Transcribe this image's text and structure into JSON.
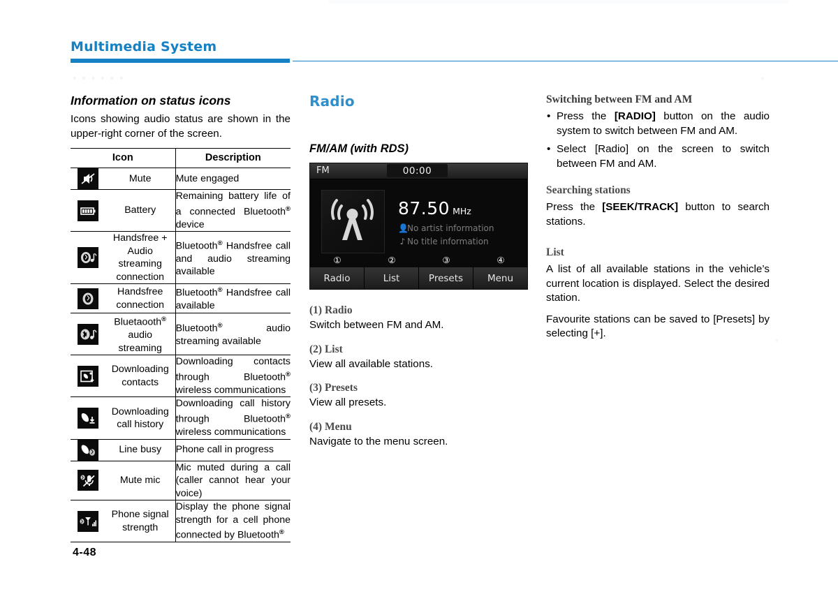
{
  "header": {
    "chapter_title": "Multimedia System",
    "rule_color": "#1580c4",
    "watermark": "• • • • • •",
    "watermark_right": "•",
    "watermark_mid": "•"
  },
  "page_number": "4-48",
  "column1": {
    "section_title": "Information on status icons",
    "intro": "Icons showing audio status are shown in the upper-right corner of the screen.",
    "table": {
      "headers": [
        "Icon",
        "Description"
      ],
      "rows": [
        {
          "icon": "mute-icon",
          "name": "Mute",
          "desc_html": "Mute engaged"
        },
        {
          "icon": "battery-icon",
          "name": "Battery",
          "desc_html": "Remaining battery life of a connected Bluetooth<sup class=\"sup-r\">®</sup> device"
        },
        {
          "icon": "handsfree-audio-streaming-icon",
          "name": "Handsfree + Audio streaming connection",
          "desc_html": "Bluetooth<sup class=\"sup-r\">®</sup> Handsfree call and audio streaming available"
        },
        {
          "icon": "handsfree-connection-icon",
          "name": "Handsfree connection",
          "desc_html": "Bluetooth<sup class=\"sup-r\">®</sup> Handsfree call available"
        },
        {
          "icon": "bluetooth-audio-streaming-icon",
          "name": "Bluetaooth<sup class=\"sup-r\">®</sup> audio streaming",
          "desc_html": "Bluetooth<sup class=\"sup-r\">®</sup> audio streaming available"
        },
        {
          "icon": "downloading-contacts-icon",
          "name": "Downloading contacts",
          "desc_html": "Downloading contacts through Bluetooth<sup class=\"sup-r\">®</sup> wireless communications"
        },
        {
          "icon": "downloading-call-history-icon",
          "name": "Downloading call history",
          "desc_html": "Downloading call history through Bluetooth<sup class=\"sup-r\">®</sup> wireless communications"
        },
        {
          "icon": "line-busy-icon",
          "name": "Line busy",
          "desc_html": "Phone call in progress"
        },
        {
          "icon": "mute-mic-icon",
          "name": "Mute mic",
          "desc_html": "Mic muted during a call (caller cannot hear your voice)"
        },
        {
          "icon": "phone-signal-strength-icon",
          "name": "Phone signal strength",
          "desc_html": "Display the phone signal strength for a cell phone connected by Bluetooth<sup class=\"sup-r\">®</sup>"
        }
      ]
    }
  },
  "column2": {
    "section_title": "Radio",
    "subsection_title": "FM/AM (with RDS)",
    "device": {
      "band": "FM",
      "clock": "00:00",
      "frequency": "87.50",
      "unit": "MHz",
      "artist_line": "No artist information",
      "title_line": "No title information",
      "artist_icon": "person-icon",
      "title_icon": "disc-icon",
      "callout_numbers": [
        "①",
        "②",
        "③",
        "④"
      ],
      "buttons": [
        "Radio",
        "List",
        "Presets",
        "Menu"
      ]
    },
    "items": [
      {
        "heading": "(1) Radio",
        "body": "Switch between FM and AM."
      },
      {
        "heading": "(2) List",
        "body": "View all available stations."
      },
      {
        "heading": "(3) Presets",
        "body": "View all presets."
      },
      {
        "heading": "(4) Menu",
        "body": "Navigate to the menu screen."
      }
    ]
  },
  "column3": {
    "blocks": [
      {
        "heading": "Switching between FM and AM",
        "bullets": [
          "Press the <span class=\"bold\">[RADIO]</span> button on the audio system to switch between FM and AM.",
          "Select [Radio] on the screen to switch between FM and AM."
        ]
      },
      {
        "heading": "Searching stations",
        "paragraphs": [
          "Press the <span class=\"bold\">[SEEK/TRACK]</span> button to search stations."
        ]
      },
      {
        "heading": "List",
        "paragraphs": [
          "A list of all available stations in the vehicle’s current location is displayed. Select the desired station.",
          "Favourite stations can be saved to [Presets] by selecting [+]."
        ]
      }
    ]
  }
}
